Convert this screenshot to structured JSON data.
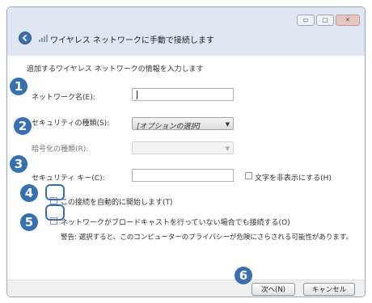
{
  "window": {
    "title": "ワイヤレス ネットワークに手動で接続します",
    "controls": {
      "minimize": "▭",
      "maximize": "▢",
      "close": "✕"
    }
  },
  "form": {
    "instruction": "追加するワイヤレス ネットワークの情報を入力します",
    "network_name_label": "ネットワーク名(E):",
    "network_name_value": "",
    "security_type_label": "セキュリティの種類(S):",
    "security_type_value": "[オプションの選択]",
    "encryption_type_label": "暗号化の種類(R):",
    "encryption_type_value": "",
    "security_key_label": "セキュリティ キー(C):",
    "security_key_value": "",
    "hide_chars_label": "文字を非表示にする(H)",
    "auto_connect_label": "この接続を自動的に開始します(T)",
    "connect_hidden_label": "ネットワークがブロードキャストを行っていない場合でも接続する(O)",
    "warning_text": "警告: 選択すると、このコンピューターのプライバシーが危険にさらされる可能性があります。"
  },
  "footer": {
    "next_label": "次へ(N)",
    "cancel_label": "キャンセル"
  },
  "annotations": [
    "1",
    "2",
    "3",
    "4",
    "5",
    "6"
  ],
  "colors": {
    "badge": "#3570b3",
    "titlebar": "#dfe8f2",
    "footer": "#f0f0f0"
  }
}
